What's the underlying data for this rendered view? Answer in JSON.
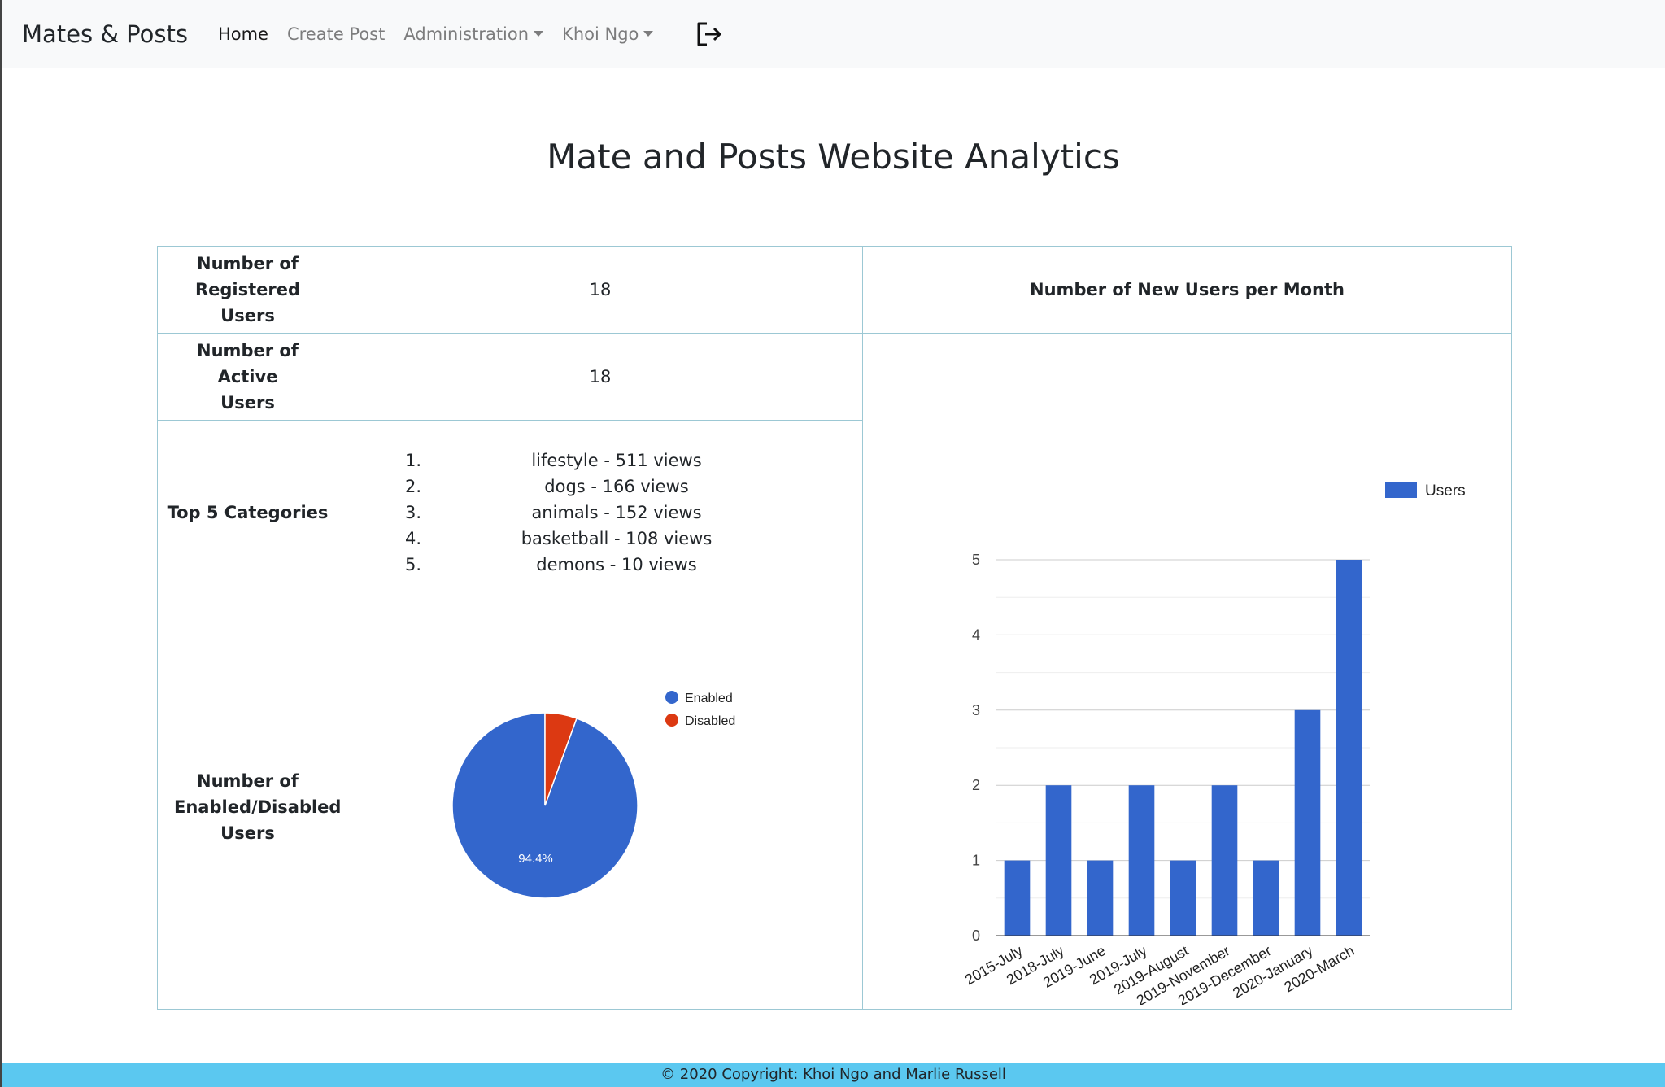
{
  "nav": {
    "brand": "Mates & Posts",
    "home": "Home",
    "create_post": "Create Post",
    "administration": "Administration",
    "user": "Khoi Ngo"
  },
  "page": {
    "title": "Mate and Posts Website Analytics"
  },
  "stats": {
    "registered_label": "Number of Registered Users",
    "registered_value": "18",
    "active_label": "Number of Active Users",
    "active_value": "18",
    "categories_label": "Top 5 Categories",
    "categories": [
      {
        "num": "1.",
        "text": "lifestyle - 511 views"
      },
      {
        "num": "2.",
        "text": "dogs - 166 views"
      },
      {
        "num": "3.",
        "text": "animals - 152 views"
      },
      {
        "num": "4.",
        "text": "basketball - 108 views"
      },
      {
        "num": "5.",
        "text": "demons - 10 views"
      }
    ],
    "enabled_label": "Number of Enabled/Disabled Users",
    "new_users_title": "Number of New Users per Month"
  },
  "footer": {
    "text": "© 2020 Copyright: Khoi Ngo and Marlie Russell"
  },
  "chart_data": [
    {
      "type": "pie",
      "labels": [
        "Enabled",
        "Disabled"
      ],
      "values": [
        17,
        1
      ],
      "colors": [
        "#3366cc",
        "#dc3912"
      ],
      "data_labels": [
        "94.4%",
        ""
      ],
      "legend": "right"
    },
    {
      "type": "bar",
      "title": "Number of New Users per Month",
      "categories": [
        "2015-July",
        "2018-July",
        "2019-June",
        "2019-July",
        "2019-August",
        "2019-November",
        "2019-December",
        "2020-January",
        "2020-March"
      ],
      "series": [
        {
          "name": "Users",
          "values": [
            1,
            2,
            1,
            2,
            1,
            2,
            1,
            3,
            5
          ]
        }
      ],
      "color": "#3366cc",
      "ylim": [
        0,
        5
      ],
      "yticks": [
        "0",
        "1",
        "2",
        "3",
        "4",
        "5"
      ],
      "grid": true,
      "legend": "right"
    }
  ]
}
